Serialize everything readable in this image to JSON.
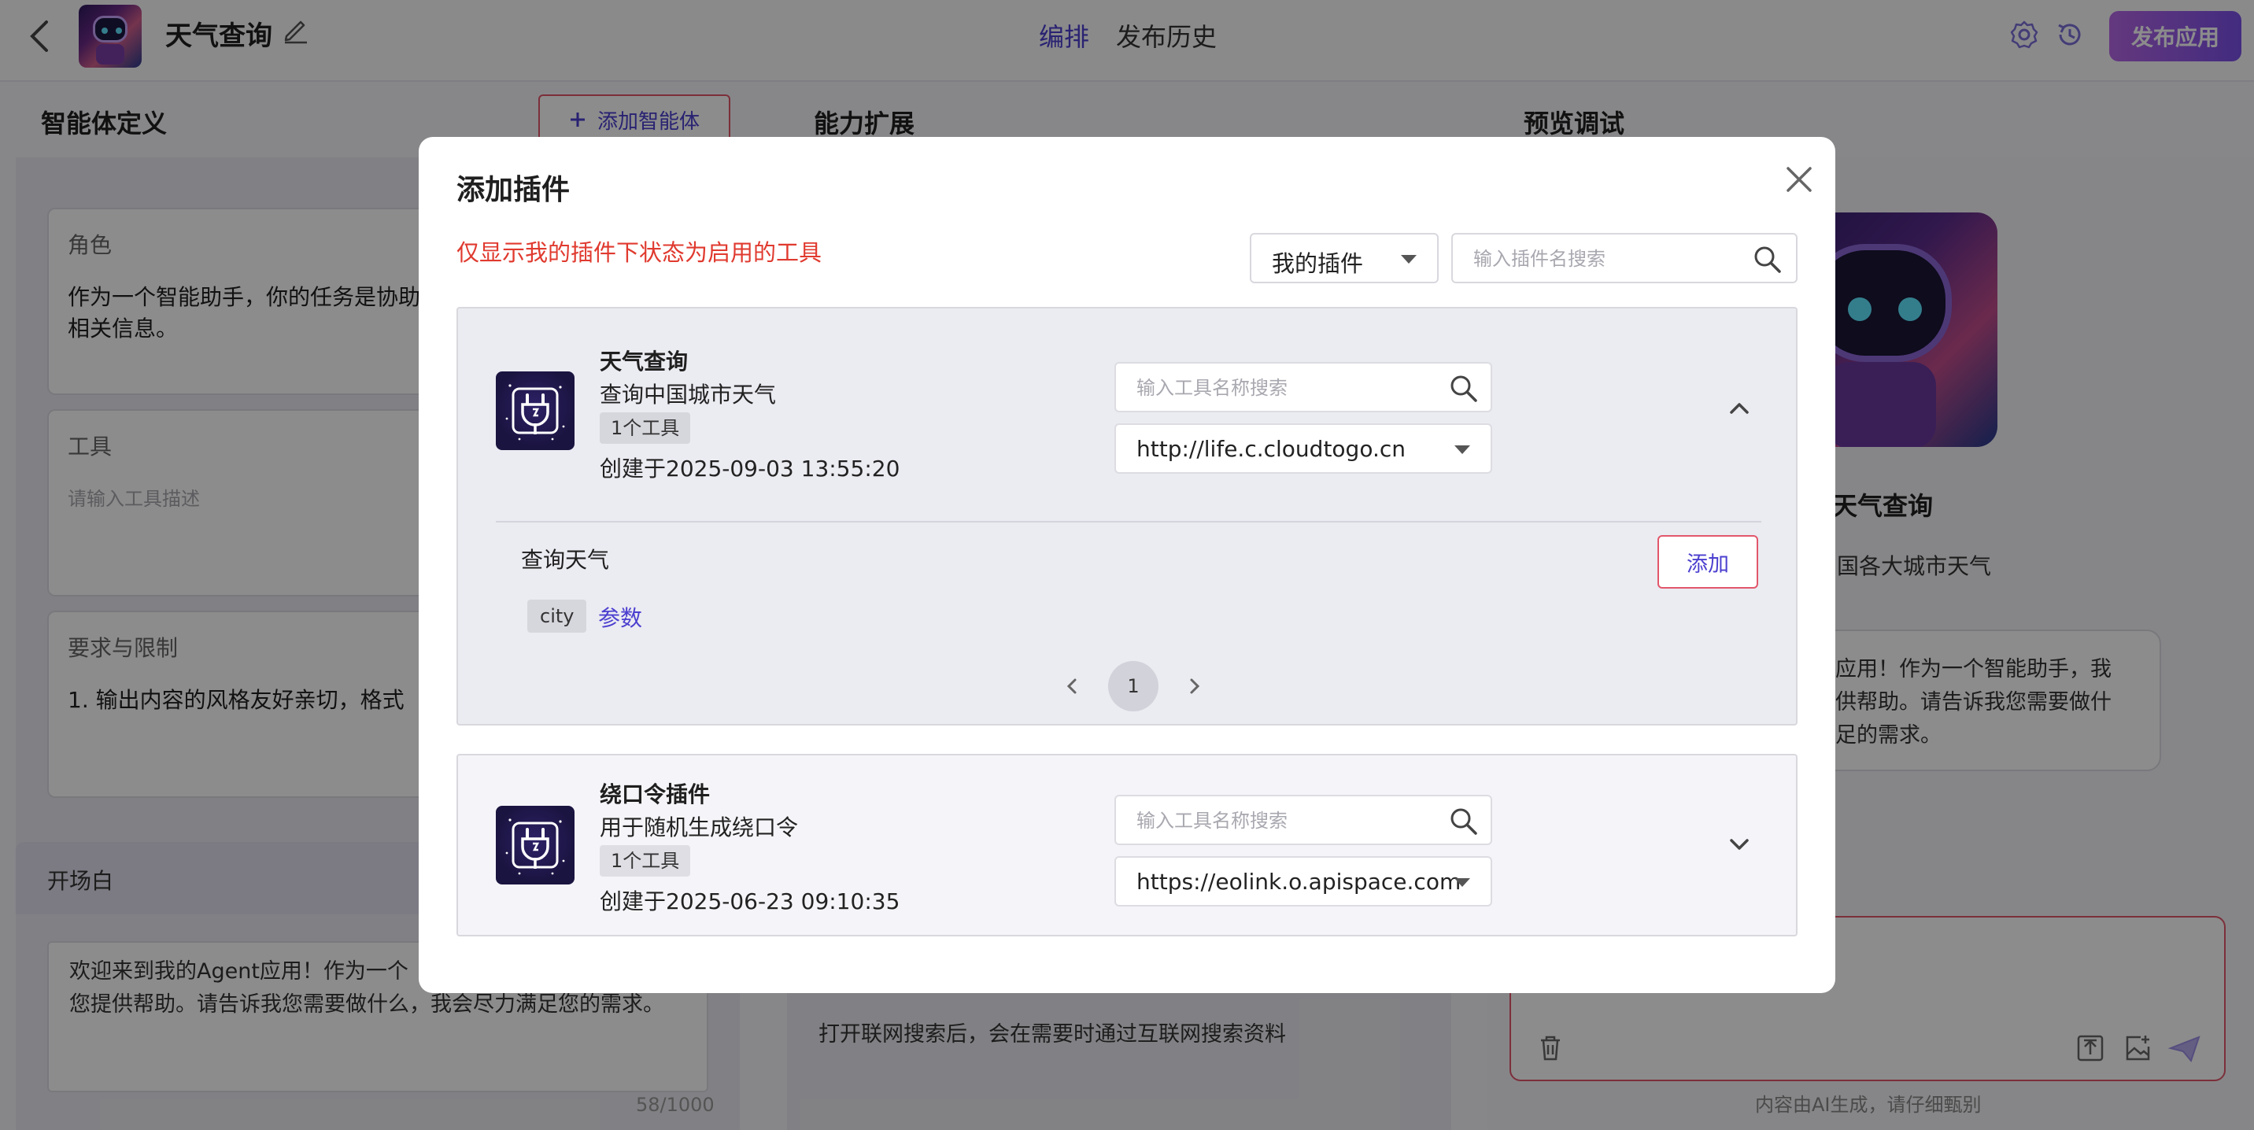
{
  "header": {
    "app_title": "天气查询",
    "tabs": [
      {
        "label": "编排",
        "active": true
      },
      {
        "label": "发布历史",
        "active": false
      }
    ],
    "publish_label": "发布应用"
  },
  "left_panel": {
    "title": "智能体定义",
    "add_agent_label": "添加智能体",
    "role": {
      "label": "角色",
      "text": "作为一个智能助手，你的任务是协助\n相关信息。"
    },
    "tools": {
      "label": "工具",
      "placeholder": "请输入工具描述"
    },
    "requirements": {
      "label": "要求与限制",
      "text": "1. 输出内容的风格友好亲切，格式"
    },
    "opening": {
      "label": "开场白",
      "text": "欢迎来到我的Agent应用！作为一个\n您提供帮助。请告诉我您需要做什么，我会尽力满足您的需求。",
      "counter": "58/1000"
    }
  },
  "middle_panel": {
    "title": "能力扩展",
    "net_search_text": "打开联网搜索后，会在需要时通过互联网搜索资料"
  },
  "right_panel": {
    "title": "预览调试",
    "name": "天气查询",
    "desc": "国各大城市天气",
    "bubble_text": "应用！作为一个智能助手，我\n供帮助。请告诉我您需要做什\n足的需求。",
    "notice": "内容由AI生成，请仔细甄别"
  },
  "modal": {
    "title": "添加插件",
    "hint": "仅显示我的插件下状态为启用的工具",
    "filter_value": "我的插件",
    "search_placeholder": "输入插件名搜索",
    "plugins": [
      {
        "name": "天气查询",
        "desc": "查询中国城市天气",
        "badge": "1个工具",
        "created": "创建于2025-09-03 13:55:20",
        "tool_search_placeholder": "输入工具名称搜索",
        "url": "http://life.c.cloudtogo.cn",
        "expanded": true,
        "tools": [
          {
            "name": "查询天气",
            "add_label": "添加",
            "param_tag": "city",
            "param_link": "参数"
          }
        ],
        "page": "1"
      },
      {
        "name": "绕口令插件",
        "desc": "用于随机生成绕口令",
        "badge": "1个工具",
        "created": "创建于2025-06-23 09:10:35",
        "tool_search_placeholder": "输入工具名称搜索",
        "url": "https://eolink.o.apispace.com",
        "expanded": false
      }
    ]
  },
  "colors": {
    "accent": "#4b3fcf",
    "danger": "#e03a2f",
    "border_accent": "#e2576b",
    "publish_from": "#b667e6",
    "publish_to": "#7a4fe8"
  }
}
